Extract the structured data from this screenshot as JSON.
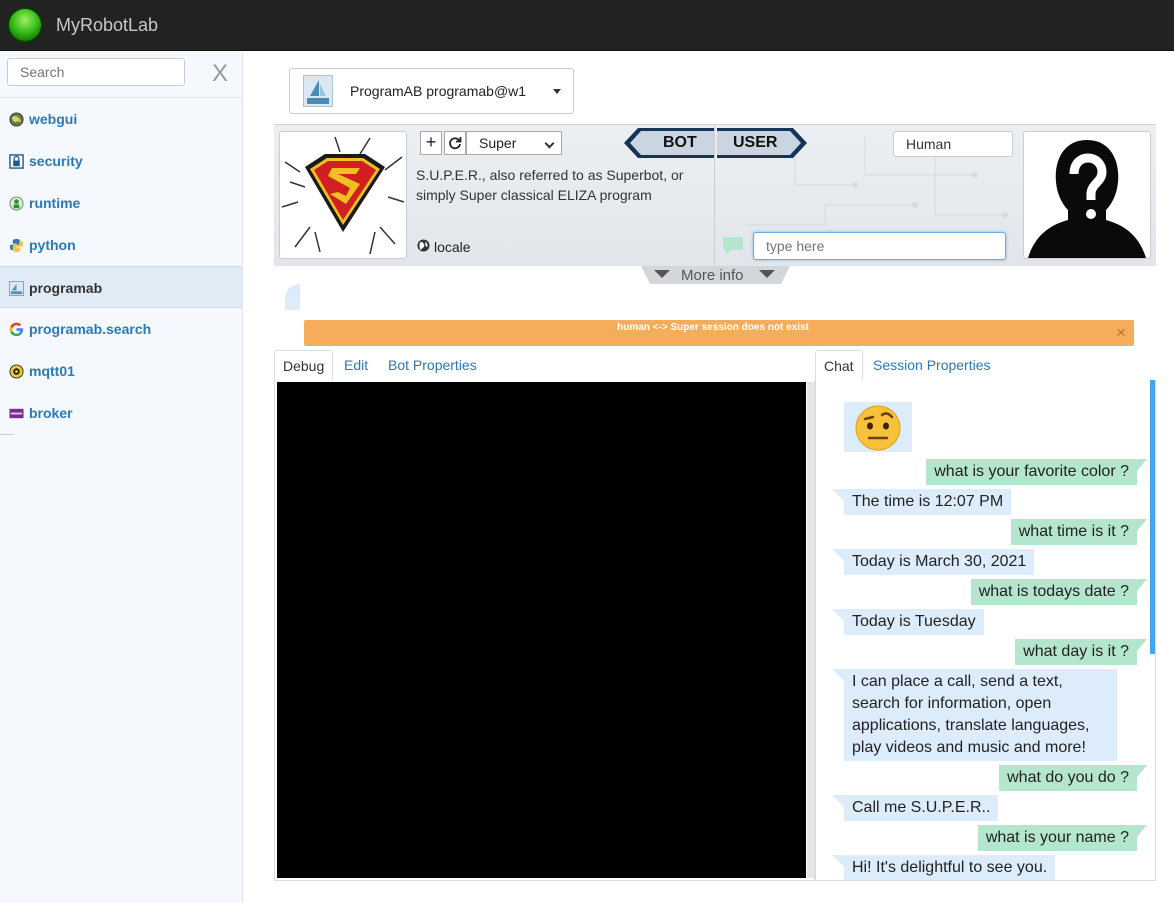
{
  "app": {
    "title": "MyRobotLab"
  },
  "sidebar": {
    "search_placeholder": "Search",
    "clear_label": "X",
    "items": [
      {
        "label": "webgui",
        "icon": "globe-icon"
      },
      {
        "label": "security",
        "icon": "lock-icon"
      },
      {
        "label": "runtime",
        "icon": "runtime-icon"
      },
      {
        "label": "python",
        "icon": "python-icon"
      },
      {
        "label": "programab",
        "icon": "alice-icon",
        "active": true
      },
      {
        "label": "programab.search",
        "icon": "google-icon"
      },
      {
        "label": "mqtt01",
        "icon": "mqtt-icon"
      },
      {
        "label": "broker",
        "icon": "mqtt-broker-icon"
      }
    ]
  },
  "service_selector": {
    "label": "ProgramAB  programab@w1"
  },
  "bot_panel": {
    "bot_select_value": "Super",
    "description": "S.U.P.E.R., also referred to as Superbot, or simply Super classical ELIZA program",
    "locale_label": "locale",
    "bot_label": "BOT",
    "user_label": "USER",
    "human_name": "Human",
    "chat_placeholder": "type here",
    "more_info": "More info"
  },
  "alert": {
    "text": "human <-> Super session does not exist",
    "close": "×"
  },
  "left_tabs": [
    "Debug",
    "Edit",
    "Bot Properties"
  ],
  "right_tabs": [
    "Chat",
    "Session Properties"
  ],
  "chat": {
    "messages": [
      {
        "from": "user",
        "text": "what is your favorite color ?"
      },
      {
        "from": "bot",
        "text": "The time is 12:07 PM"
      },
      {
        "from": "user",
        "text": "what time is it ?"
      },
      {
        "from": "bot",
        "text": "Today is March 30, 2021"
      },
      {
        "from": "user",
        "text": "what is todays date ?"
      },
      {
        "from": "bot",
        "text": "Today is Tuesday"
      },
      {
        "from": "user",
        "text": "what day is it ?"
      },
      {
        "from": "bot",
        "text": "I can place a call, send a text, search for information, open applications, translate languages, play videos and music and more!"
      },
      {
        "from": "user",
        "text": "what do you do ?"
      },
      {
        "from": "bot",
        "text": "Call me S.U.P.E.R.."
      },
      {
        "from": "user",
        "text": "what is your name ?"
      },
      {
        "from": "bot",
        "text": "Hi! It's delightful to see you."
      }
    ]
  },
  "colors": {
    "accent": "#2a7ab8",
    "alert": "#f5ad5b",
    "bot_bubble": "#dcecfa",
    "user_bubble": "#b3e6cc",
    "scrollbar": "#42a5f5"
  }
}
